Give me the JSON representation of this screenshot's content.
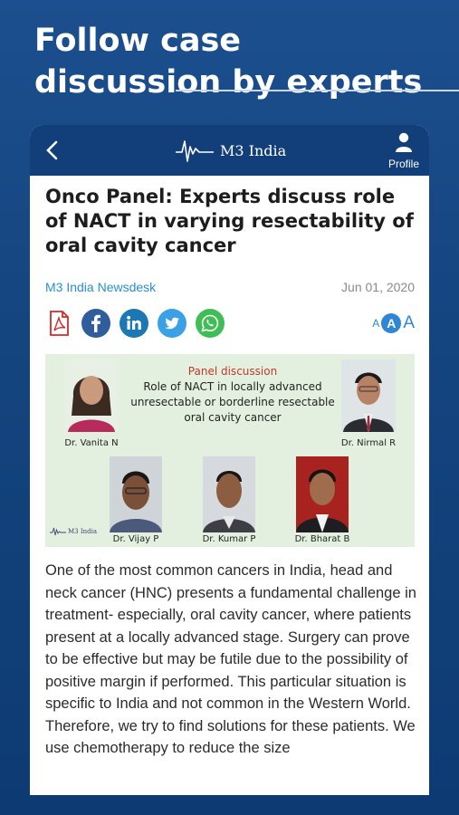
{
  "promo": {
    "title": "Follow case discussion by experts"
  },
  "appbar": {
    "logo_text": "M3 India",
    "profile_label": "Profile"
  },
  "article": {
    "headline": "Onco Panel: Experts discuss role of NACT in varying resectability of oral cavity cancer",
    "author": "M3 India Newsdesk",
    "date": "Jun 01, 2020",
    "share_icons": [
      "pdf-icon",
      "facebook-icon",
      "linkedin-icon",
      "twitter-icon",
      "whatsapp-icon"
    ],
    "font_size_labels": [
      "A",
      "A",
      "A"
    ],
    "panel": {
      "title": "Panel discussion",
      "subtitle": "Role of NACT in locally advanced unresectable or borderline resectable oral cavity cancer",
      "logo_text": "M3 India",
      "experts": [
        "Dr. Vanita N",
        "Dr. Nirmal R",
        "Dr. Vijay P",
        "Dr. Kumar P",
        "Dr. Bharat B"
      ]
    },
    "body": "One of the most common cancers in India, head and neck cancer (HNC) presents a fundamental challenge in treatment- especially, oral cavity cancer, where patients present at a locally advanced stage. Surgery can prove to be effective but may be futile due to the possibility of positive margin if performed. This particular situation is specific to India and not common in the Western World. Therefore, we try to find solutions for these patients. We use chemotherapy to reduce the size"
  },
  "colors": {
    "appbar": "#123f7a",
    "link": "#2a8fd1",
    "facebook": "#2f5d9e",
    "linkedin": "#1b78b5",
    "twitter": "#3aa1e6",
    "whatsapp": "#3fbe55",
    "pdf": "#d02b2b",
    "panel_bg": "#e4f0df"
  }
}
